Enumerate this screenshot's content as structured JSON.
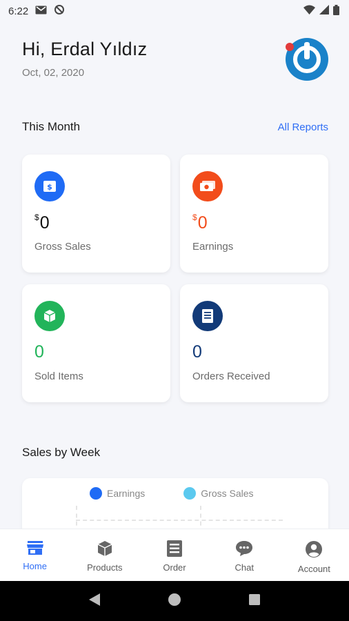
{
  "status_bar": {
    "time": "6:22"
  },
  "header": {
    "greeting": "Hi, Erdal Yıldız",
    "date": "Oct, 02, 2020"
  },
  "this_month": {
    "title": "This Month",
    "link_label": "All Reports",
    "cards": [
      {
        "currency": "$",
        "value": "0",
        "label": "Gross Sales",
        "icon": "dollar-bill-icon",
        "color": "#1f6bf5"
      },
      {
        "currency": "$",
        "value": "0",
        "label": "Earnings",
        "icon": "cash-icon",
        "color": "#f24c1b"
      },
      {
        "currency": "",
        "value": "0",
        "label": "Sold Items",
        "icon": "box-icon",
        "color": "#22b45a"
      },
      {
        "currency": "",
        "value": "0",
        "label": "Orders Received",
        "icon": "receipt-icon",
        "color": "#123a78"
      }
    ]
  },
  "sales_by_week": {
    "title": "Sales by Week",
    "legend": [
      {
        "name": "Earnings",
        "color": "#1f6bf5"
      },
      {
        "name": "Gross Sales",
        "color": "#5bc9ef"
      }
    ]
  },
  "bottom_nav": {
    "items": [
      {
        "label": "Home",
        "icon": "store-icon",
        "active": true
      },
      {
        "label": "Products",
        "icon": "package-icon",
        "active": false
      },
      {
        "label": "Order",
        "icon": "order-list-icon",
        "active": false
      },
      {
        "label": "Chat",
        "icon": "chat-bubble-icon",
        "active": false
      },
      {
        "label": "Account",
        "icon": "account-circle-icon",
        "active": false
      }
    ]
  },
  "colors": {
    "accent": "#2f6ef5",
    "background": "#f5f6fa"
  }
}
